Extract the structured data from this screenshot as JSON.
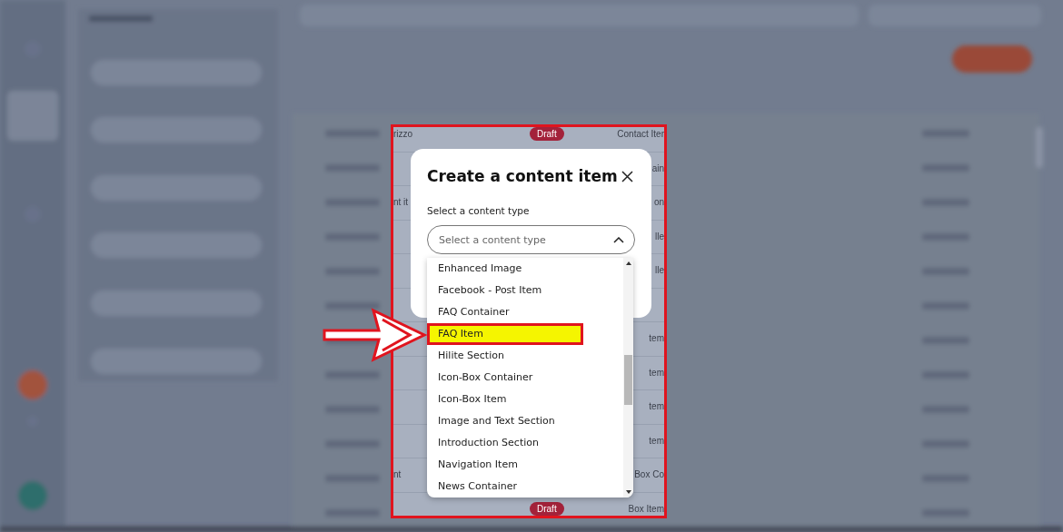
{
  "table_fragment": {
    "rows": [
      {
        "name": "rizzo",
        "status": "Draft",
        "type": "Contact Iter"
      },
      {
        "type": "ain"
      },
      {
        "name": "nt it",
        "type": "on"
      },
      {
        "type": "lle"
      },
      {
        "type": "lle"
      },
      {},
      {
        "type": "tem"
      },
      {
        "type": "tem"
      },
      {
        "type": "tem"
      },
      {
        "type": "tem"
      },
      {
        "name": "nt",
        "type": "Box Co"
      },
      {
        "status": "Draft",
        "type": "Box Item"
      }
    ]
  },
  "modal": {
    "title": "Create a content item",
    "label": "Select a content type",
    "select": {
      "placeholder": "Select a content type",
      "expanded": true
    },
    "options": [
      {
        "label": "Enhanced Image",
        "selected": false
      },
      {
        "label": "Facebook - Post Item",
        "selected": false
      },
      {
        "label": "FAQ Container",
        "selected": false
      },
      {
        "label": "FAQ Item",
        "selected": true
      },
      {
        "label": "Hilite Section",
        "selected": false
      },
      {
        "label": "Icon-Box Container",
        "selected": false
      },
      {
        "label": "Icon-Box Item",
        "selected": false
      },
      {
        "label": "Image and Text Section",
        "selected": false
      },
      {
        "label": "Introduction Section",
        "selected": false
      },
      {
        "label": "Navigation Item",
        "selected": false
      },
      {
        "label": "News Container",
        "selected": false
      }
    ]
  }
}
